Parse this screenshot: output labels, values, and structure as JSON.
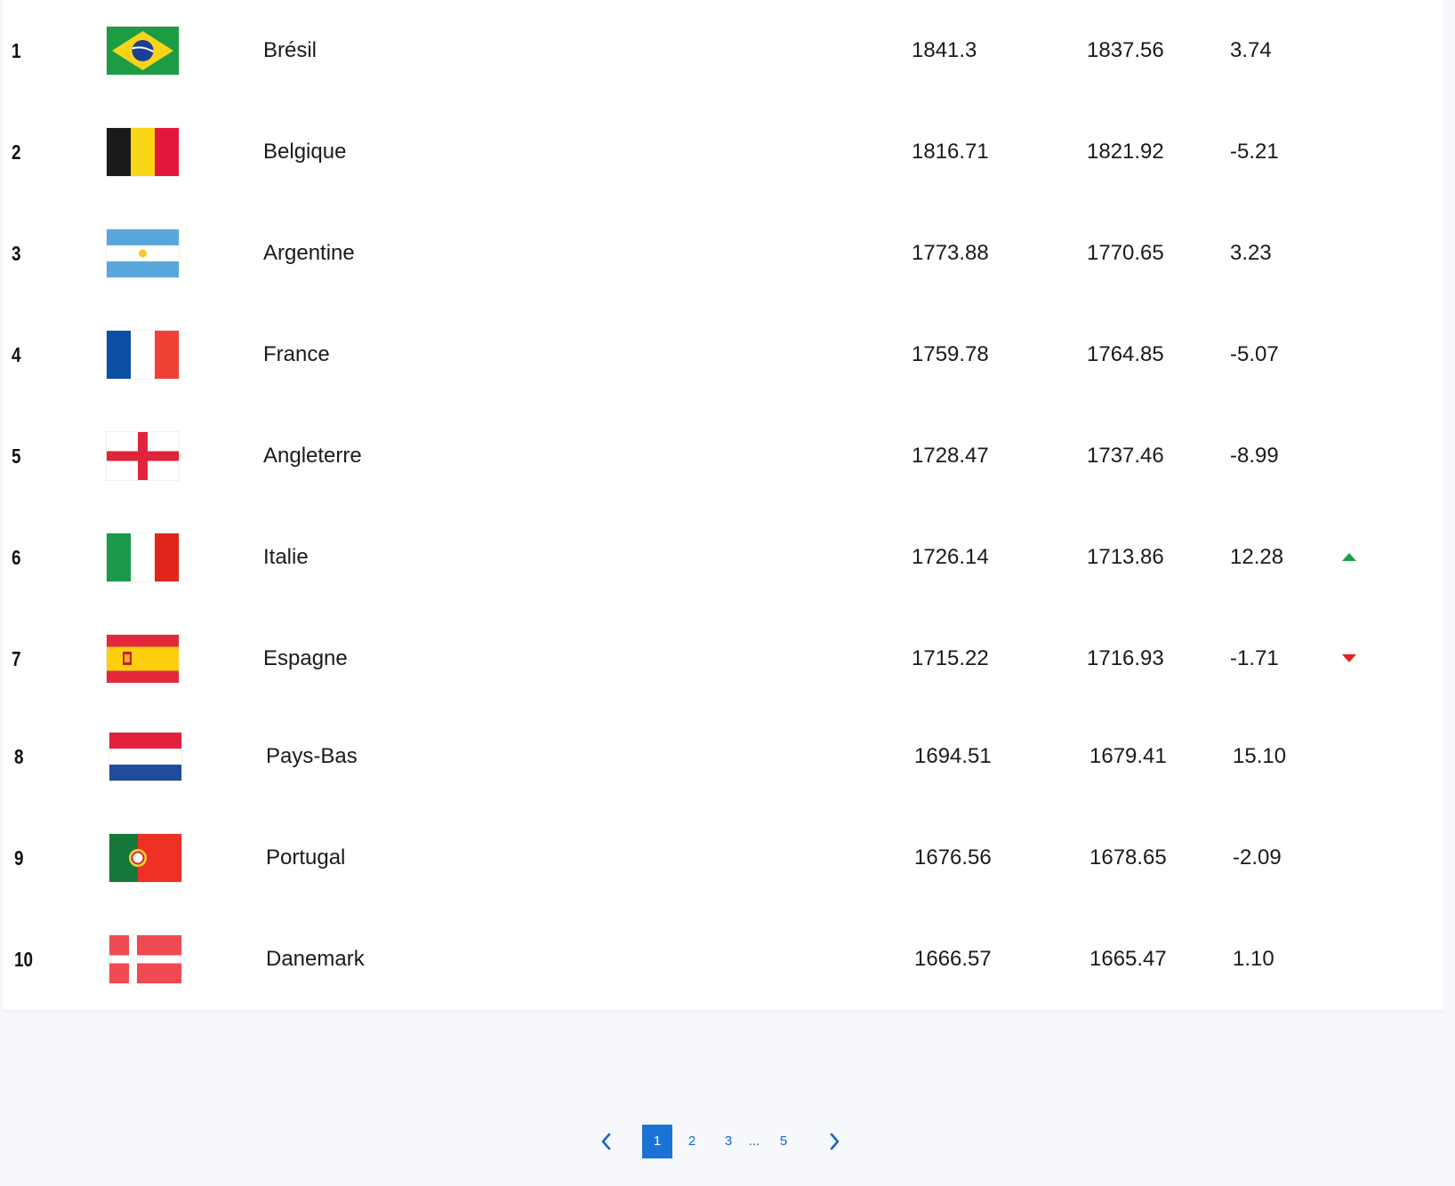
{
  "colors": {
    "up": "#1aa04a",
    "down": "#e0261b",
    "page_active_bg": "#1b73d6",
    "page_link": "#1766c7"
  },
  "rows": [
    {
      "rank": "1",
      "flag": "brazil-flag-icon",
      "name": "Brésil",
      "points": "1841.3",
      "prev": "1837.56",
      "delta": "3.74",
      "trend": ""
    },
    {
      "rank": "2",
      "flag": "belgium-flag-icon",
      "name": "Belgique",
      "points": "1816.71",
      "prev": "1821.92",
      "delta": "-5.21",
      "trend": ""
    },
    {
      "rank": "3",
      "flag": "argentina-flag-icon",
      "name": "Argentine",
      "points": "1773.88",
      "prev": "1770.65",
      "delta": "3.23",
      "trend": ""
    },
    {
      "rank": "4",
      "flag": "france-flag-icon",
      "name": "France",
      "points": "1759.78",
      "prev": "1764.85",
      "delta": "-5.07",
      "trend": ""
    },
    {
      "rank": "5",
      "flag": "england-flag-icon",
      "name": "Angleterre",
      "points": "1728.47",
      "prev": "1737.46",
      "delta": "-8.99",
      "trend": ""
    },
    {
      "rank": "6",
      "flag": "italy-flag-icon",
      "name": "Italie",
      "points": "1726.14",
      "prev": "1713.86",
      "delta": "12.28",
      "trend": "up"
    },
    {
      "rank": "7",
      "flag": "spain-flag-icon",
      "name": "Espagne",
      "points": "1715.22",
      "prev": "1716.93",
      "delta": "-1.71",
      "trend": "down"
    },
    {
      "rank": "8",
      "flag": "netherlands-flag-icon",
      "name": "Pays-Bas",
      "points": "1694.51",
      "prev": "1679.41",
      "delta": "15.10",
      "trend": ""
    },
    {
      "rank": "9",
      "flag": "portugal-flag-icon",
      "name": "Portugal",
      "points": "1676.56",
      "prev": "1678.65",
      "delta": "-2.09",
      "trend": ""
    },
    {
      "rank": "10",
      "flag": "denmark-flag-icon",
      "name": "Danemark",
      "points": "1666.57",
      "prev": "1665.47",
      "delta": "1.10",
      "trend": ""
    }
  ],
  "pagination": {
    "prev_icon": "chevron-left-icon",
    "next_icon": "chevron-right-icon",
    "pages": [
      "1",
      "2",
      "3",
      "5"
    ],
    "ellipsis": "...",
    "current": "1"
  }
}
